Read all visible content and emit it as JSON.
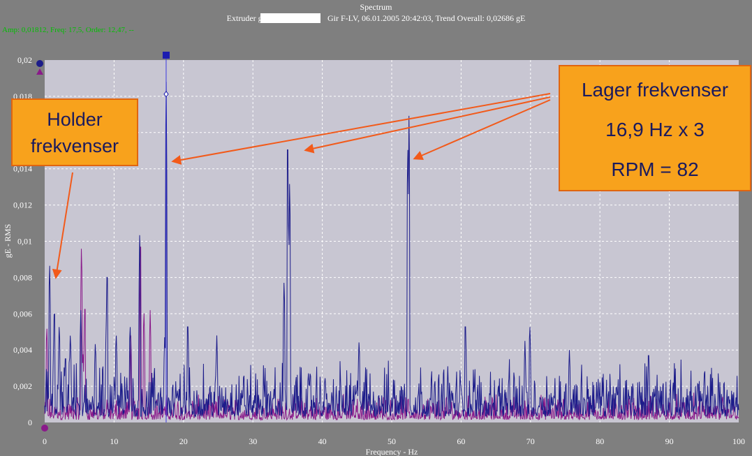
{
  "header": {
    "title": "Spectrum",
    "subtitle_left": "Extruder gir",
    "subtitle_right": "Gir F-LV, 06.01.2005 20:42:03, Trend Overall: 0,02686 gE",
    "readout": "Amp: 0,01812, Freq: 17,5, Order: 12,47, --"
  },
  "callouts": {
    "holder": [
      "Holder",
      "frekvenser"
    ],
    "lager": [
      "Lager frekvenser",
      "16,9 Hz x 3",
      "RPM = 82"
    ]
  },
  "colors": {
    "background": "#7f7f7f",
    "plot_area": "#c8c6d2",
    "series_1": "#1c1c8a",
    "series_2": "#8a1a8a",
    "callout_fill": "#f8a21c",
    "arrow": "#f25a1a"
  },
  "chart_data": {
    "type": "line",
    "xlabel": "Frequency - Hz",
    "ylabel": "gE - RMS",
    "xlim": [
      0,
      100
    ],
    "ylim": [
      0,
      0.02
    ],
    "x_ticks": [
      "0",
      "10",
      "20",
      "30",
      "40",
      "50",
      "60",
      "70",
      "80",
      "90",
      "100"
    ],
    "y_ticks": [
      "0",
      "0,002",
      "0,004",
      "0,006",
      "0,008",
      "0,01",
      "0,012",
      "0,014",
      "0,016",
      "0,018",
      "0,02"
    ],
    "grid": true,
    "cursor": {
      "freq": 17.5,
      "amp": 0.01812
    },
    "series": [
      {
        "color": "#1c1c8a",
        "noise_floor": 0.0013,
        "peaks": [
          [
            0.7,
            0.0092
          ],
          [
            1.4,
            0.0068
          ],
          [
            2.1,
            0.0056
          ],
          [
            3.0,
            0.004
          ],
          [
            3.7,
            0.0051
          ],
          [
            5.2,
            0.0062
          ],
          [
            7.3,
            0.0046
          ],
          [
            8.9,
            0.0062
          ],
          [
            9.0,
            0.0091
          ],
          [
            10.3,
            0.0051
          ],
          [
            12.3,
            0.0056
          ],
          [
            13.7,
            0.011
          ],
          [
            17.3,
            0.005
          ],
          [
            17.5,
            0.02
          ],
          [
            20.6,
            0.006
          ],
          [
            24.8,
            0.0048
          ],
          [
            34.5,
            0.0082
          ],
          [
            35.0,
            0.0171
          ],
          [
            35.3,
            0.014
          ],
          [
            45.3,
            0.0047
          ],
          [
            52.3,
            0.016
          ],
          [
            52.5,
            0.018
          ],
          [
            60.6,
            0.006
          ],
          [
            69.2,
            0.0045
          ],
          [
            69.9,
            0.0056
          ],
          [
            75.6,
            0.004
          ],
          [
            87.0,
            0.0042
          ]
        ]
      },
      {
        "color": "#8a1a8a",
        "noise_floor": 0.0006,
        "peaks": [
          [
            0.3,
            0.0055
          ],
          [
            5.3,
            0.0102
          ],
          [
            5.8,
            0.0071
          ],
          [
            13.8,
            0.011
          ],
          [
            14.3,
            0.0064
          ],
          [
            15.2,
            0.0062
          ],
          [
            5.5,
            0.004
          ],
          [
            12.4,
            0.0048
          ]
        ]
      }
    ]
  }
}
